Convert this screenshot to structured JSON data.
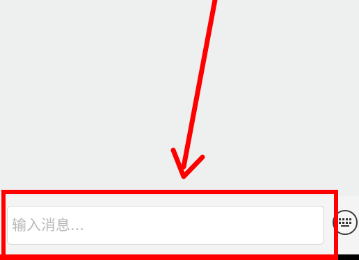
{
  "message_input": {
    "placeholder": "输入消息..."
  },
  "icons": {
    "keyboard": "keyboard-icon",
    "arrow": "red-arrow-annotation"
  },
  "colors": {
    "annotation": "#ff0000",
    "background": "#eeefef",
    "placeholder": "#b9b9b9"
  }
}
